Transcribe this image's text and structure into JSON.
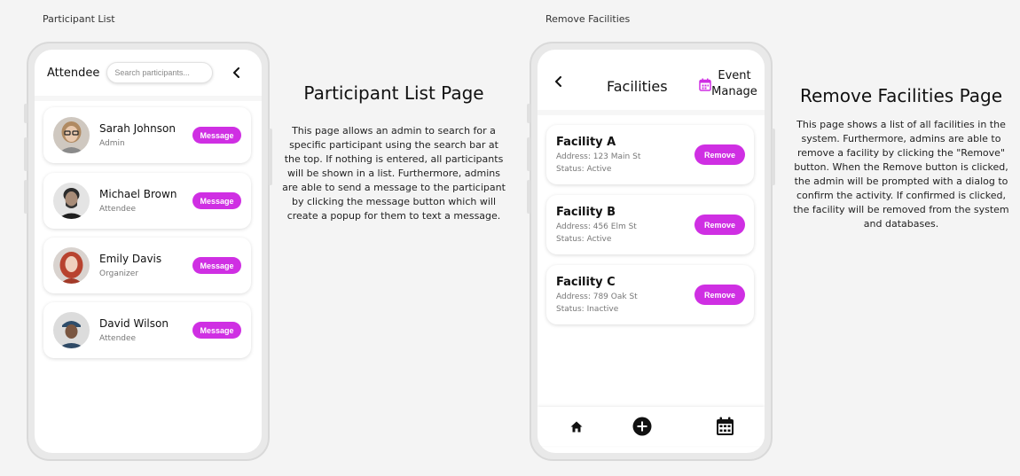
{
  "labels": {
    "left_frame": "Participant List",
    "right_frame": "Remove Facilities"
  },
  "participants": {
    "header_title": "Attendee",
    "search": {
      "placeholder": "Search participants...",
      "value": ""
    },
    "button_label": "Message",
    "items": [
      {
        "name": "Sarah Johnson",
        "role": "Admin"
      },
      {
        "name": "Michael Brown",
        "role": "Attendee"
      },
      {
        "name": "Emily Davis",
        "role": "Organizer"
      },
      {
        "name": "David Wilson",
        "role": "Attendee"
      }
    ]
  },
  "participant_desc": {
    "title": "Participant List Page",
    "body": "This page allows an admin to search for a specific participant using the search bar at the top. If nothing is entered, all participants will be shown in a list. Furthermore, admins are able to send a message to the participant by clicking the message button which will create a popup for them to text a message."
  },
  "facilities": {
    "header_title": "Facilities",
    "manage_label_line1": "Event",
    "manage_label_line2": "Manage",
    "button_label": "Remove",
    "items": [
      {
        "name": "Facility A",
        "address": "Address: 123 Main St",
        "status": "Status: Active"
      },
      {
        "name": "Facility B",
        "address": "Address: 456 Elm St",
        "status": "Status: Active"
      },
      {
        "name": "Facility C",
        "address": "Address: 789 Oak St",
        "status": "Status: Inactive"
      }
    ]
  },
  "facilities_desc": {
    "title": "Remove Facilities Page",
    "body": "This page shows a list of all facilities in the system. Furthermore, admins are able to remove a facility by clicking the \"Remove\" button. When the Remove button is clicked, the admin will be prompted with a dialog to confirm the activity. If confirmed is clicked, the facility will be removed from the system and databases."
  },
  "icons": {
    "avatars": [
      "avatar-sarah",
      "avatar-michael",
      "avatar-emily",
      "avatar-david"
    ],
    "back": "chevron-left-icon",
    "calendar": "calendar-icon",
    "nav": [
      "home-icon",
      "add-circle-icon",
      "calendar-icon"
    ]
  },
  "colors": {
    "accent": "#cf2fe3",
    "background": "#f4f4f4",
    "card": "#ffffff"
  }
}
